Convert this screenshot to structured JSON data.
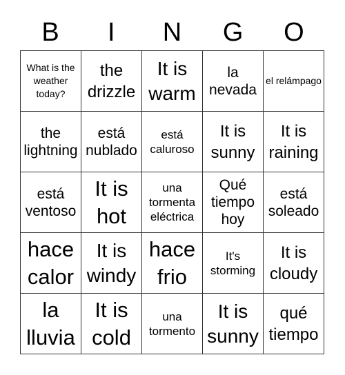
{
  "header": {
    "letters": [
      "B",
      "I",
      "N",
      "G",
      "O"
    ]
  },
  "cells": [
    [
      "What is the weather today?",
      "the drizzle",
      "It is warm",
      "la nevada",
      "el relámpago"
    ],
    [
      "the lightning",
      "está nublado",
      "está caluroso",
      "It is sunny",
      "It is raining"
    ],
    [
      "está ventoso",
      "It is hot",
      "una tormenta eléctrica",
      "Qué tiempo hoy",
      "está soleado"
    ],
    [
      "hace calor",
      "It is windy",
      "hace frio",
      "It's storming",
      "It is cloudy"
    ],
    [
      "la lluvia",
      "It is cold",
      "una tormento",
      "It is sunny",
      "qué tiempo"
    ]
  ],
  "colors": {
    "grid_line": "#333333",
    "text": "#000000",
    "background": "#ffffff"
  }
}
